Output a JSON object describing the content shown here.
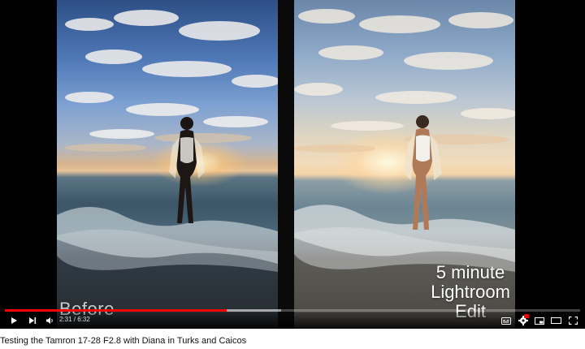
{
  "video": {
    "title": "Testing the Tamron 17-28 F2.8 with Diana in Turks and Caicos",
    "before_label": "Before",
    "edit_label_line1": "5 minute",
    "edit_label_line2": "Lightroom",
    "edit_label_line3": "Edit"
  },
  "player": {
    "current_time": "2:31",
    "duration": "6:32",
    "time_separator": " / ",
    "played_fraction": 0.385,
    "buffered_fraction": 0.48,
    "accent_color": "#ff0000"
  },
  "icons": {
    "play": "play-icon",
    "next": "next-icon",
    "volume": "volume-icon",
    "captions": "captions-icon",
    "settings": "settings-icon",
    "miniplayer": "miniplayer-icon",
    "theater": "theater-icon",
    "fullscreen": "fullscreen-icon"
  }
}
